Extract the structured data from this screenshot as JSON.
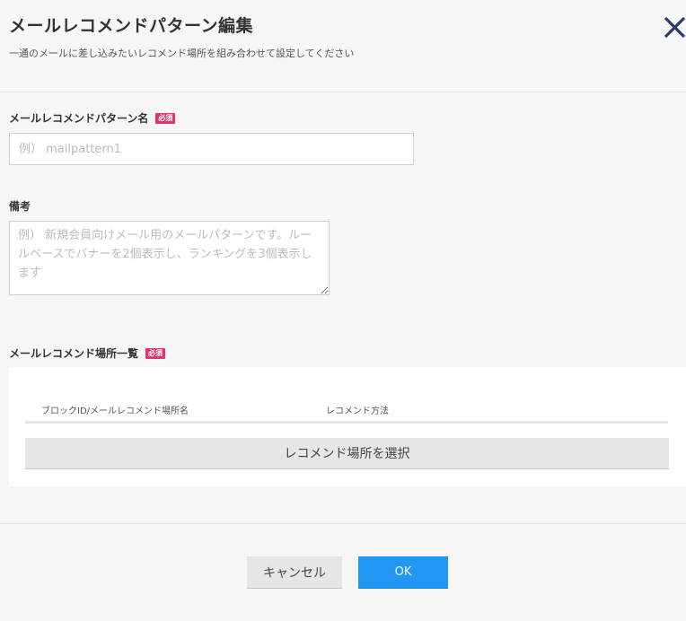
{
  "header": {
    "title": "メールレコメンドパターン編集",
    "subtitle": "一通のメールに差し込みたいレコメンド場所を組み合わせて設定してください",
    "close_icon": "close-icon"
  },
  "form": {
    "pattern_name": {
      "label": "メールレコメンドパターン名",
      "required_badge": "必須",
      "value": "",
      "placeholder": "例） mailpattern1"
    },
    "notes": {
      "label": "備考",
      "value": "",
      "placeholder": "例） 新規会員向けメール用のメールパターンです。ルールベースでバナーを2個表示し、ランキングを3個表示します"
    },
    "placements": {
      "label": "メールレコメンド場所一覧",
      "required_badge": "必須",
      "columns": [
        "ブロックID/メールレコメンド場所名",
        "レコメンド方法"
      ],
      "rows": [],
      "select_button": "レコメンド場所を選択"
    }
  },
  "footer": {
    "cancel_label": "キャンセル",
    "ok_label": "OK"
  },
  "colors": {
    "background": "#f6f6f6",
    "required_badge": "#e2336b",
    "primary_button": "#2196f3",
    "close_icon": "#2a3b6e"
  }
}
